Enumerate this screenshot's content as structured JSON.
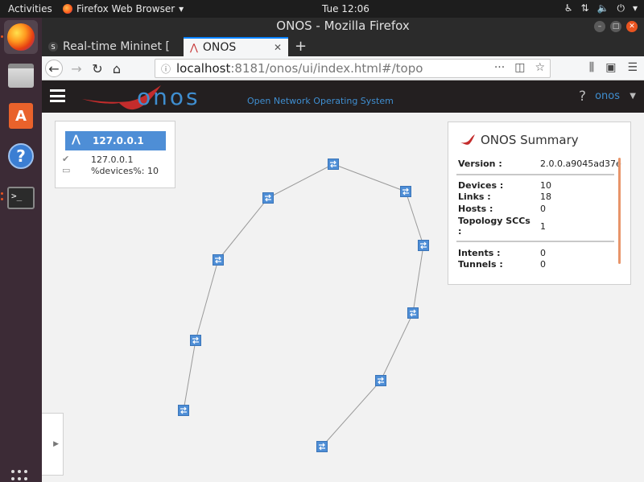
{
  "topbar": {
    "activities": "Activities",
    "app_name": "Firefox Web Browser",
    "clock": "Tue 12:06"
  },
  "dock": {
    "items": [
      "firefox",
      "files",
      "software-center",
      "help",
      "terminal"
    ]
  },
  "window": {
    "title": "ONOS - Mozilla Firefox"
  },
  "tabs": [
    {
      "label": "Real-time Mininet [",
      "favicon": "S"
    },
    {
      "label": "ONOS"
    }
  ],
  "navbar": {
    "url_host": "localhost",
    "url_rest": ":8181/onos/ui/index.html#/topo"
  },
  "onos_header": {
    "logo_text": "onos",
    "subtitle": "Open Network Operating System",
    "help": "?",
    "user": "onos"
  },
  "instance_panel": {
    "header_ip": "127.0.0.1",
    "row_ip": "127.0.0.1",
    "row_devices": "%devices%: 10"
  },
  "summary": {
    "title": "ONOS Summary",
    "version_label": "Version :",
    "version_value": "2.0.0.a9045ad37e",
    "rows": [
      {
        "label": "Devices :",
        "value": "10"
      },
      {
        "label": "Links :",
        "value": "18"
      },
      {
        "label": "Hosts :",
        "value": "0"
      },
      {
        "label": "Topology SCCs :",
        "value": "1"
      }
    ],
    "rows2": [
      {
        "label": "Intents :",
        "value": "0"
      },
      {
        "label": "Tunnels :",
        "value": "0"
      }
    ]
  },
  "colors": {
    "onos_blue": "#3f8ed0",
    "device_blue": "#4e8ed6",
    "onos_red": "#c42c2c",
    "accent_orange": "#e95420"
  }
}
